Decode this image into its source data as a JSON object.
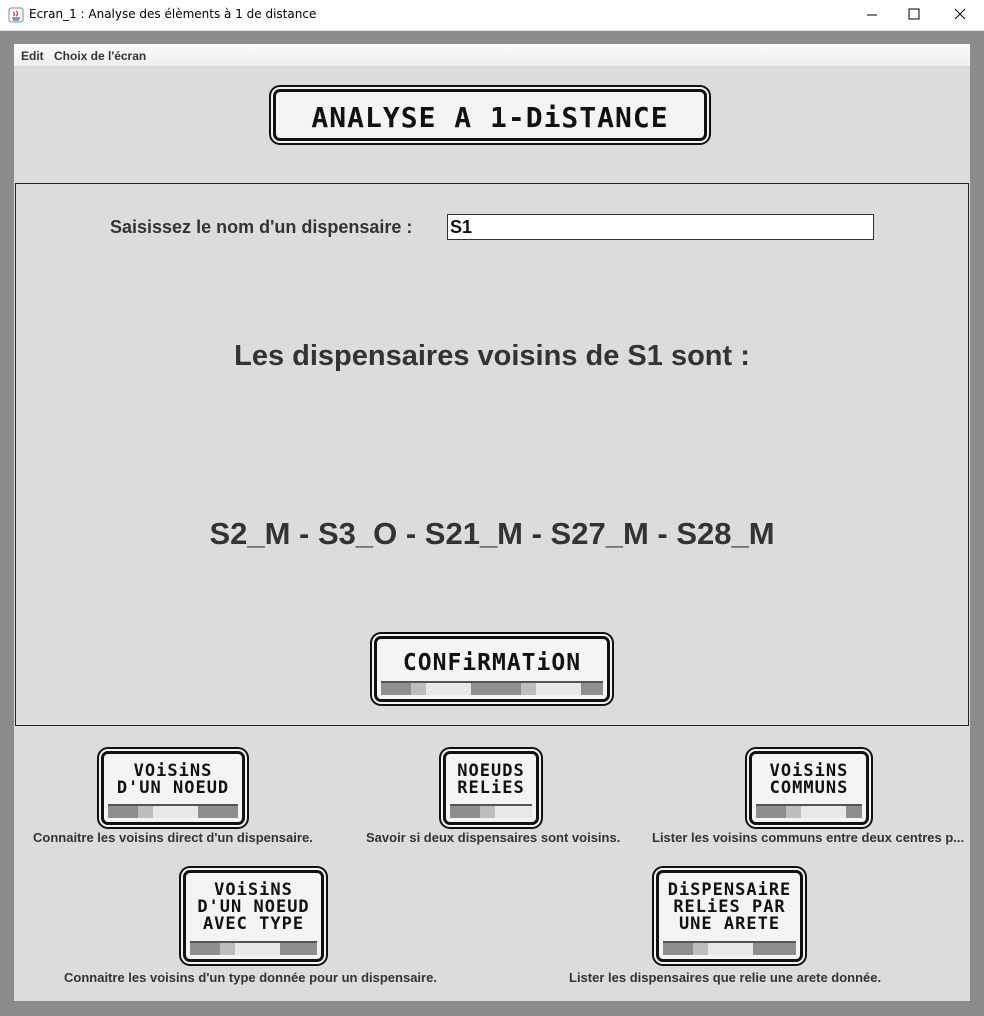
{
  "window": {
    "title": "Ecran_1 : Analyse des élèments à 1 de distance"
  },
  "menu": {
    "edit": "Edit",
    "choix": "Choix de l'écran"
  },
  "banner": {
    "title": "ANALYSE A 1-DiSTANCE"
  },
  "form": {
    "prompt": "Saisissez le nom d'un dispensaire :",
    "value": "S1"
  },
  "result": {
    "heading": "Les dispensaires voisins de S1 sont :",
    "list": "S2_M - S3_O - S21_M - S27_M - S28_M"
  },
  "confirm_label": "CONFiRMATiON",
  "nav": [
    {
      "label": "VOiSiNS\nD'UN NOEUD",
      "description": "Connaitre les voisins direct d'un dispensaire."
    },
    {
      "label": "NOEUDS\nRELiES",
      "description": "Savoir si deux dispensaires sont voisins."
    },
    {
      "label": "VOiSiNS\nCOMMUNS",
      "description": "Lister les voisins communs entre deux centres p..."
    },
    {
      "label": "VOiSiNS\nD'UN NOEUD\nAVEC TYPE",
      "description": "Connaitre les voisins d'un type donnée pour un dispensaire."
    },
    {
      "label": "DiSPENSAiRE\nRELiES PAR\nUNE ARETE",
      "description": "Lister les dispensaires que relie une arete donnée."
    }
  ]
}
